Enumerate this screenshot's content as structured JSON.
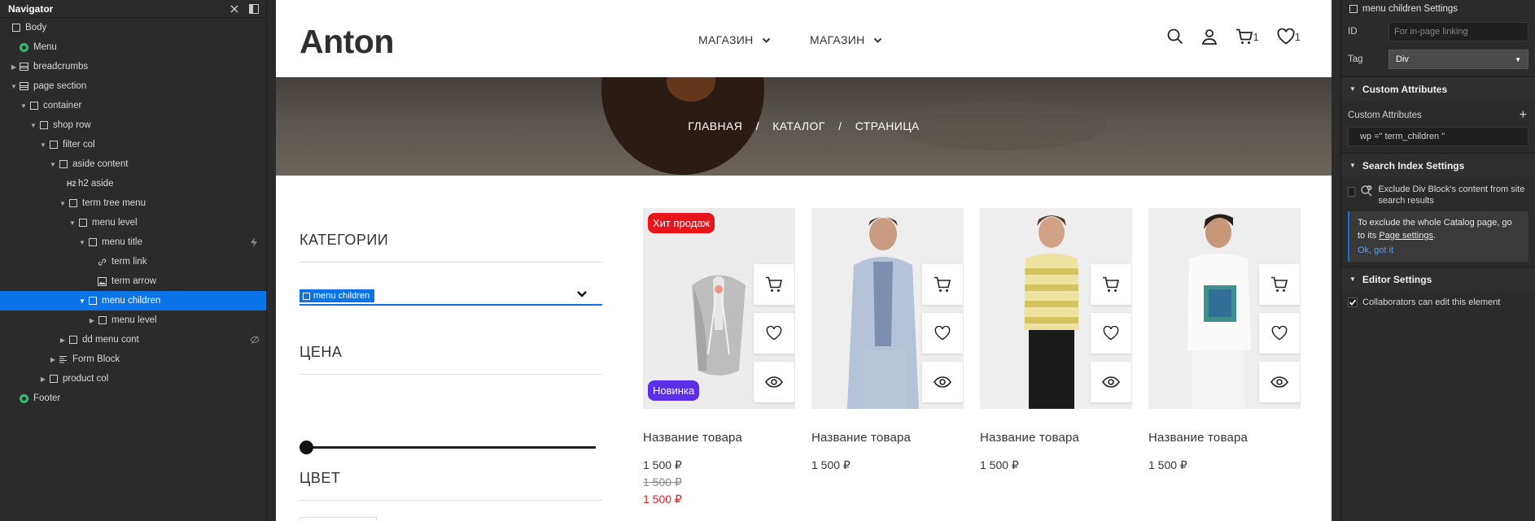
{
  "navigator": {
    "title": "Navigator",
    "items": [
      {
        "label": "Body"
      },
      {
        "label": "Menu"
      },
      {
        "label": "breadcrumbs"
      },
      {
        "label": "page section"
      },
      {
        "label": "container"
      },
      {
        "label": "shop row"
      },
      {
        "label": "filter col"
      },
      {
        "label": "aside content"
      },
      {
        "label": "h2 aside"
      },
      {
        "label": "term tree menu"
      },
      {
        "label": "menu level"
      },
      {
        "label": "menu title"
      },
      {
        "label": "term link"
      },
      {
        "label": "term arrow"
      },
      {
        "label": "menu children"
      },
      {
        "label": "menu level"
      },
      {
        "label": "dd menu cont"
      },
      {
        "label": "Form Block"
      },
      {
        "label": "product col"
      },
      {
        "label": "Footer"
      }
    ]
  },
  "site": {
    "logo": "Anton",
    "menu": [
      "МАГАЗИН",
      "МАГАЗИН"
    ],
    "cart_count": "1",
    "wish_count": "1",
    "breadcrumbs": [
      "ГЛАВНАЯ",
      "/",
      "КАТАЛОГ",
      "/",
      "СТРАНИЦА"
    ],
    "filters": {
      "categories": "КАТЕГОРИИ",
      "selected_chip": "menu children",
      "price": "ЦЕНА",
      "color": "ЦВЕТ"
    },
    "products": [
      {
        "name": "Название товара",
        "price": "1 500 ₽",
        "old_price": "1 500 ₽",
        "sale_price": "1 500 ₽",
        "badge_top": "Хит продаж",
        "badge_bottom": "Новинка"
      },
      {
        "name": "Название товара",
        "price": "1 500 ₽"
      },
      {
        "name": "Название товара",
        "price": "1 500 ₽"
      },
      {
        "name": "Название товара",
        "price": "1 500 ₽"
      }
    ],
    "colors": {
      "badge_hit": "#e8141c",
      "badge_new": "#5b2ee8",
      "sale": "#e02020"
    }
  },
  "settings": {
    "title": "menu children Settings",
    "id_label": "ID",
    "id_placeholder": "For in-page linking",
    "tag_label": "Tag",
    "tag_value": "Div",
    "custom_attributes_head": "Custom Attributes",
    "custom_attributes_label": "Custom Attributes",
    "attribute_value": "wp =\" term_children \"",
    "search_head": "Search Index Settings",
    "exclude_text": "Exclude Div Block's content from site search results",
    "info_text_1": "To exclude the whole Catalog page, go to its",
    "info_link": "Page settings",
    "info_ok": "Ok, got it",
    "editor_head": "Editor Settings",
    "collab_text": "Collaborators can edit this element"
  }
}
